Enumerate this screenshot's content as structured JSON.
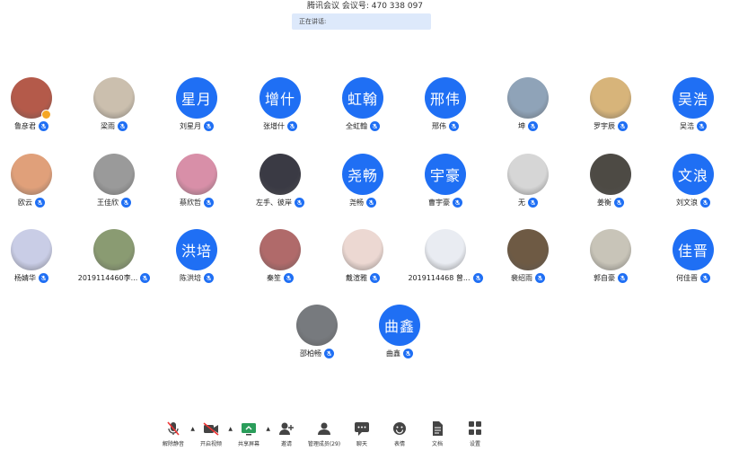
{
  "header": {
    "app_name": "腾讯会议",
    "meeting_label": "会议号:",
    "meeting_id": "470 338 097"
  },
  "speaking": {
    "label": "正在讲话:"
  },
  "colors": {
    "accent": "#1f6ff4",
    "speaking_bg": "#dde9fb",
    "host_badge": "#f5a623"
  },
  "participants": [
    {
      "name": "鲁彦君",
      "avatar_text": "",
      "avatar_color": "#b45a4a",
      "host": true
    },
    {
      "name": "梁雨",
      "avatar_text": "",
      "avatar_color": "#cbbfae"
    },
    {
      "name": "刘星月",
      "avatar_text": "星月"
    },
    {
      "name": "张增什",
      "avatar_text": "增什"
    },
    {
      "name": "全虹翰",
      "avatar_text": "虹翰"
    },
    {
      "name": "邢伟",
      "avatar_text": "邢伟"
    },
    {
      "name": "坤",
      "avatar_text": "",
      "avatar_color": "#8fa3b8"
    },
    {
      "name": "罗宇辰",
      "avatar_text": "",
      "avatar_color": "#d7b47a"
    },
    {
      "name": "吴浩",
      "avatar_text": "吴浩"
    },
    {
      "name": "欧云",
      "avatar_text": "",
      "avatar_color": "#e0a07a"
    },
    {
      "name": "王佳欣",
      "avatar_text": "",
      "avatar_color": "#9a9a9a"
    },
    {
      "name": "蔡欣哲",
      "avatar_text": "",
      "avatar_color": "#d88fa8"
    },
    {
      "name": "左手、彼岸",
      "avatar_text": "",
      "avatar_color": "#3a3a44"
    },
    {
      "name": "尧畅",
      "avatar_text": "尧畅"
    },
    {
      "name": "曹宇豪",
      "avatar_text": "宇豪"
    },
    {
      "name": "无",
      "avatar_text": "",
      "avatar_color": "#d6d6d6"
    },
    {
      "name": "姜衡",
      "avatar_text": "",
      "avatar_color": "#4d4a44"
    },
    {
      "name": "刘文浪",
      "avatar_text": "文浪"
    },
    {
      "name": "杨婧华",
      "avatar_text": "",
      "avatar_color": "#c9cde6"
    },
    {
      "name": "2019114460李...",
      "avatar_text": "",
      "avatar_color": "#8a9b72"
    },
    {
      "name": "陈洪培",
      "avatar_text": "洪培"
    },
    {
      "name": "秦笙",
      "avatar_text": "",
      "avatar_color": "#b06a6a"
    },
    {
      "name": "戴渲雅",
      "avatar_text": "",
      "avatar_color": "#ecd8d2"
    },
    {
      "name": "2019114468 曾...",
      "avatar_text": "",
      "avatar_color": "#e9ecf2"
    },
    {
      "name": "裴绍雨",
      "avatar_text": "",
      "avatar_color": "#6e5a44"
    },
    {
      "name": "郭自豪",
      "avatar_text": "",
      "avatar_color": "#c8c4b8"
    },
    {
      "name": "何佳晋",
      "avatar_text": "佳晋"
    },
    {
      "name": "邵柏畅",
      "avatar_text": "",
      "avatar_color": "#777a7e"
    },
    {
      "name": "曲鑫",
      "avatar_text": "曲鑫"
    }
  ],
  "toolbar": {
    "mute": "解除静音",
    "video": "开启视频",
    "share": "共享屏幕",
    "invite": "邀请",
    "members": "管理成员(29)",
    "chat": "聊天",
    "emoji": "表情",
    "docs": "文档",
    "settings": "设置"
  }
}
